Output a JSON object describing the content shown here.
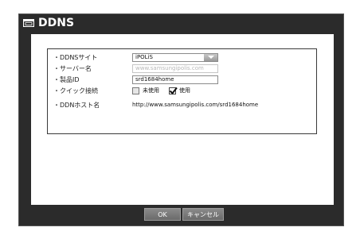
{
  "dialog": {
    "title": "DDNS",
    "title_icon": "window-icon"
  },
  "form": {
    "ddns_site": {
      "label": "・DDNSサイト",
      "value": "iPOLiS"
    },
    "server_name": {
      "label": "・サーバー名",
      "placeholder": "www.samsungipolis.com"
    },
    "product_id": {
      "label": "・製品ID",
      "value": "srd1684home"
    },
    "quick_connect": {
      "label": "・クイック接続",
      "option_unused": {
        "label": "未使用",
        "checked": false
      },
      "option_used": {
        "label": "使用",
        "checked": true
      }
    },
    "ddn_host": {
      "label": "・DDNホスト名",
      "value": "http://www.samsungipolis.com/srd1684home"
    }
  },
  "buttons": {
    "ok": "OK",
    "cancel": "キャンセル"
  }
}
